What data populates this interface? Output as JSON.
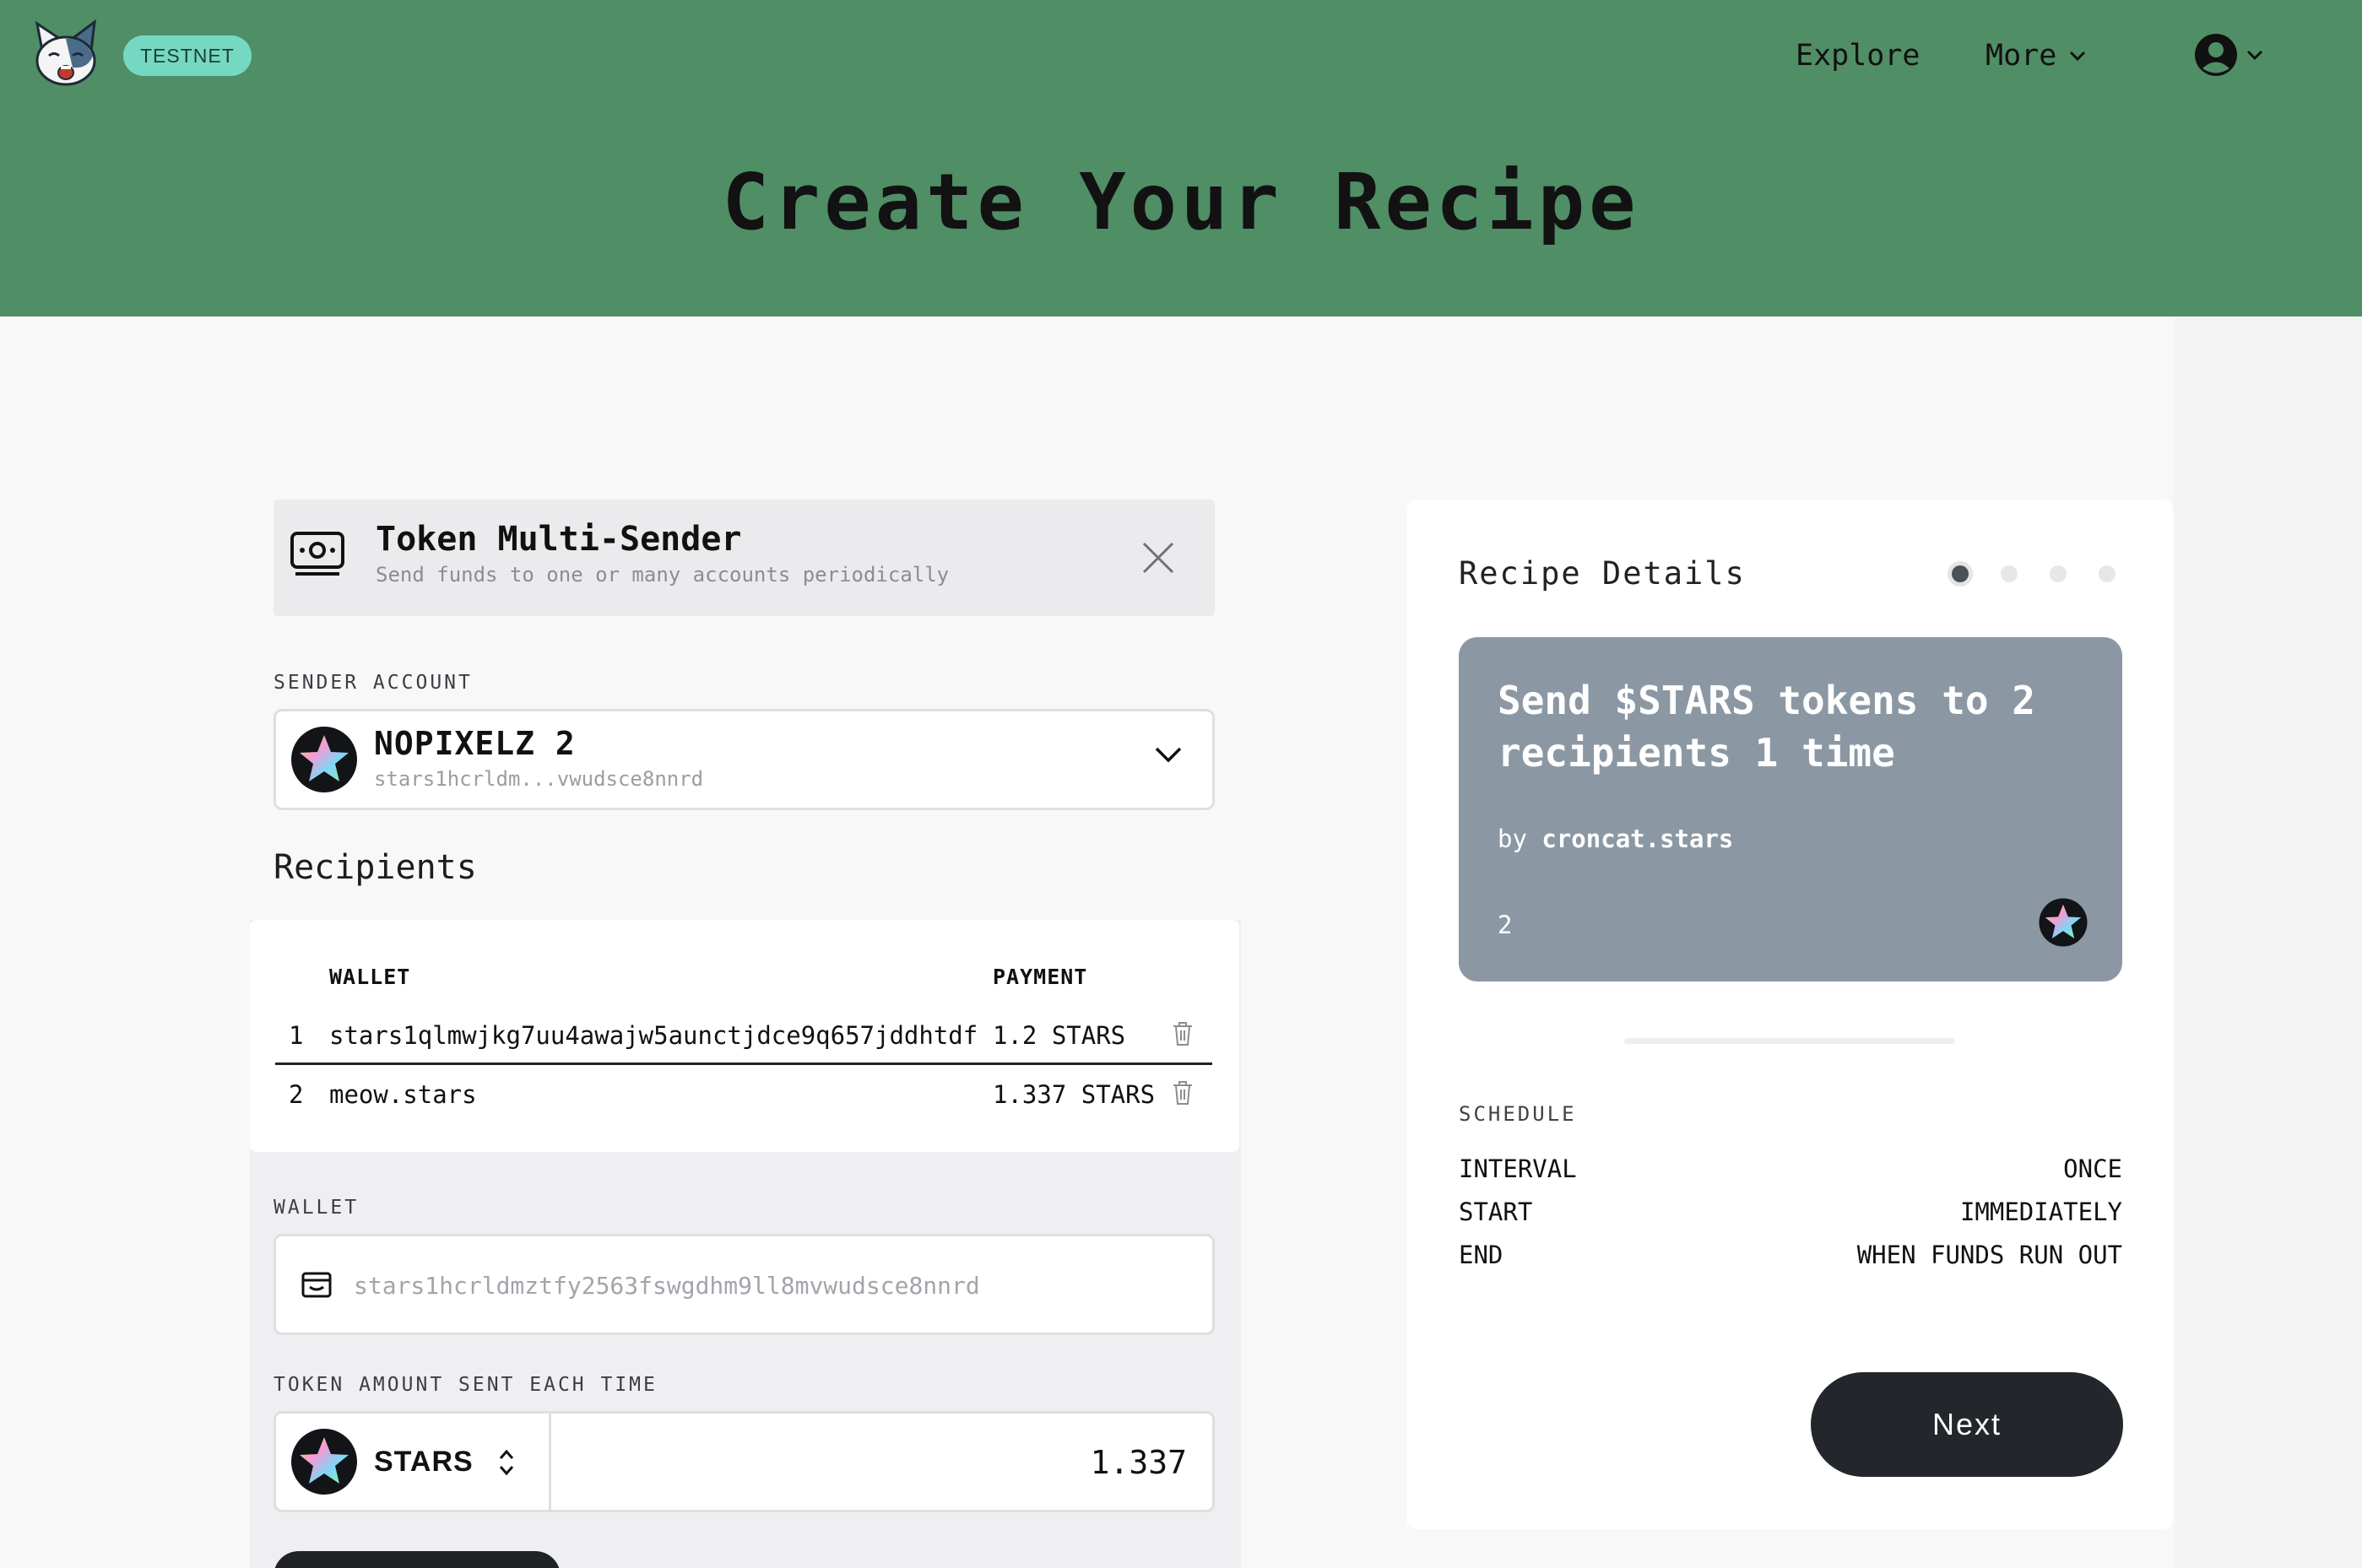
{
  "header": {
    "logo_icon": "cat-mascot-icon",
    "network_badge": "TESTNET",
    "nav": {
      "explore": "Explore",
      "more": "More"
    },
    "avatar_icon": "user-circle-icon",
    "background_color": "#508e66"
  },
  "page": {
    "title": "Create Your Recipe"
  },
  "recipe": {
    "icon": "money-icon",
    "name": "Token Multi-Sender",
    "description": "Send funds to one or many accounts periodically"
  },
  "sender": {
    "label": "SENDER ACCOUNT",
    "name": "NOPIXELZ 2",
    "address": "stars1hcrldm...vwudsce8nnrd"
  },
  "recipients": {
    "heading": "Recipients",
    "columns": {
      "wallet": "WALLET",
      "payment": "PAYMENT"
    },
    "rows": [
      {
        "index": "1",
        "wallet": "stars1qlmwjkg7uu4awajw5aunctjdce9q657jddhtdf",
        "payment": "1.2 STARS"
      },
      {
        "index": "2",
        "wallet": "meow.stars",
        "payment": "1.337 STARS"
      }
    ]
  },
  "wallet_field": {
    "label": "WALLET",
    "value": "stars1hcrldmztfy2563fswgdhm9ll8mvwudsce8nnrd"
  },
  "token_field": {
    "label": "TOKEN AMOUNT SENT EACH TIME",
    "token": "STARS",
    "amount": "1.337"
  },
  "details": {
    "title": "Recipe Details",
    "steps_total": 4,
    "step_active": 1,
    "summary": {
      "title": "Send $STARS tokens to 2 recipients 1 time",
      "by_prefix": "by",
      "author": "croncat.stars",
      "count": "2",
      "card_color": "#8b98a4"
    },
    "schedule": {
      "label": "SCHEDULE",
      "rows": [
        {
          "key": "INTERVAL",
          "value": "ONCE"
        },
        {
          "key": "START",
          "value": "IMMEDIATELY"
        },
        {
          "key": "END",
          "value": "WHEN FUNDS RUN OUT"
        }
      ]
    },
    "next_label": "Next"
  }
}
